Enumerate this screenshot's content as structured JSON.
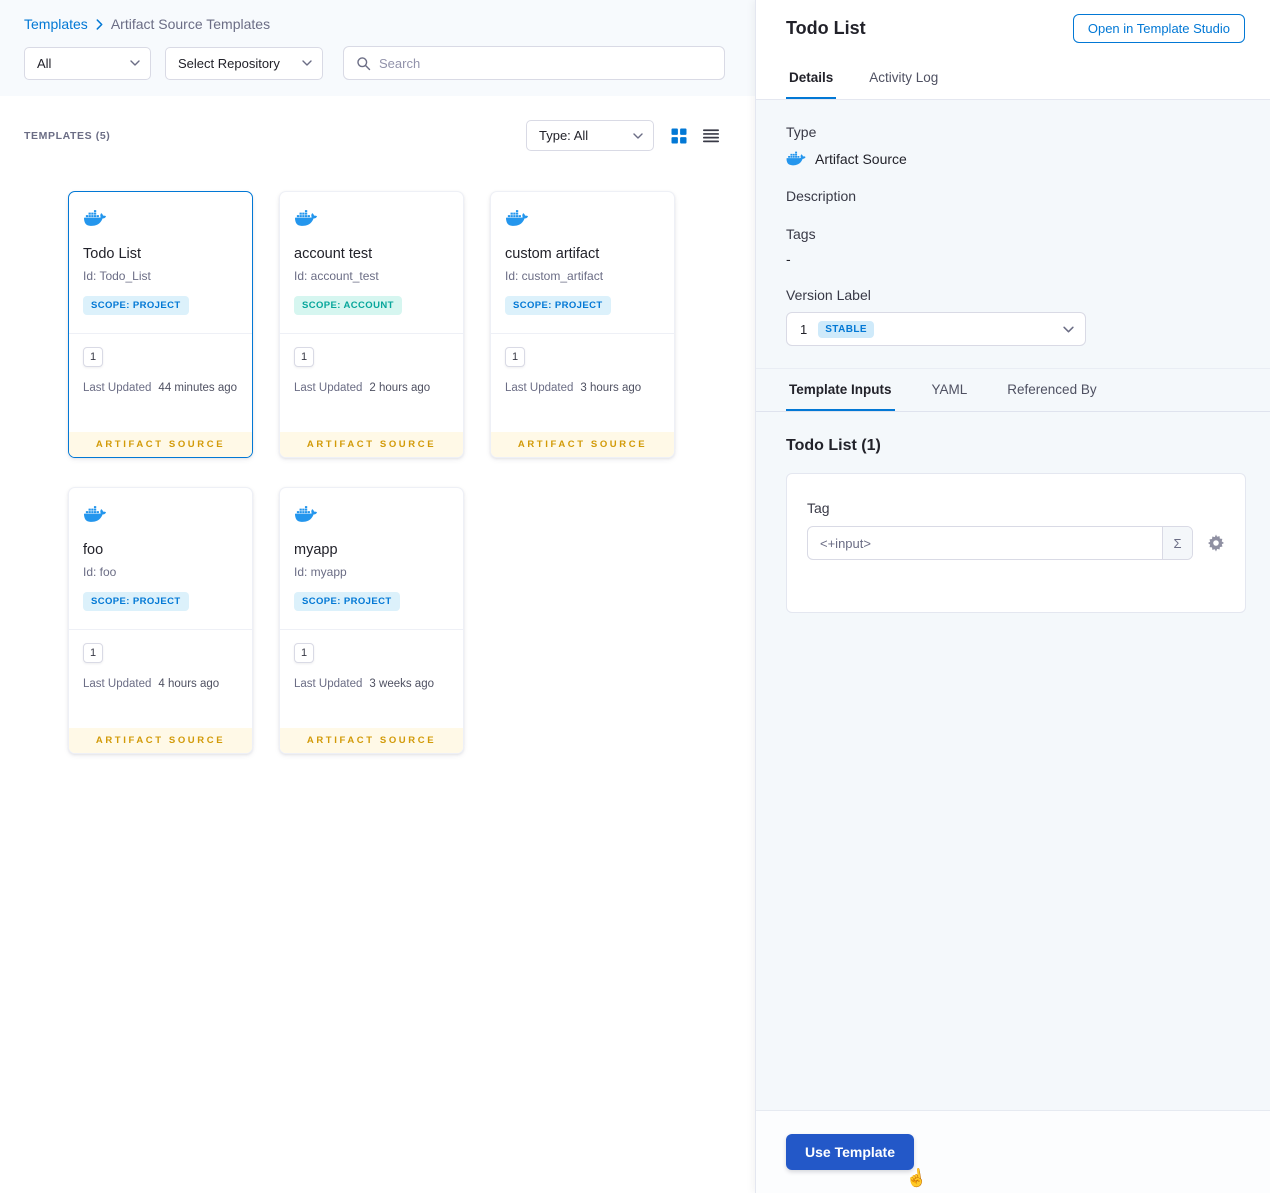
{
  "colors": {
    "accent": "#0278d5",
    "docker_blue": "#2496ed",
    "artifact_footer_text": "#d29a08",
    "artifact_footer_bg": "#fff9e7",
    "scope_project_bg": "#dcf1fb",
    "scope_project_text": "#0278d5",
    "scope_account_bg": "#d6f6f0",
    "scope_account_text": "#07a69b",
    "stable_badge_bg": "#cfeafa",
    "use_template_bg": "#2358c8"
  },
  "breadcrumb": {
    "root": "Templates",
    "current": "Artifact Source Templates"
  },
  "filters": {
    "scope": "All",
    "repository": "Select Repository",
    "search_placeholder": "Search"
  },
  "list_header": {
    "count": "TEMPLATES (5)",
    "type_filter": "Type: All"
  },
  "labels": {
    "last_updated": "Last Updated"
  },
  "cards": [
    {
      "name": "Todo List",
      "id": "Id: Todo_List",
      "scope": "SCOPE: PROJECT",
      "version": "1",
      "last_updated": "44 minutes ago",
      "footer": "ARTIFACT SOURCE"
    },
    {
      "name": "account test",
      "id": "Id: account_test",
      "scope": "SCOPE: ACCOUNT",
      "version": "1",
      "last_updated": "2 hours ago",
      "footer": "ARTIFACT SOURCE"
    },
    {
      "name": "custom artifact",
      "id": "Id: custom_artifact",
      "scope": "SCOPE: PROJECT",
      "version": "1",
      "last_updated": "3 hours ago",
      "footer": "ARTIFACT SOURCE"
    },
    {
      "name": "foo",
      "id": "Id: foo",
      "scope": "SCOPE: PROJECT",
      "version": "1",
      "last_updated": "4 hours ago",
      "footer": "ARTIFACT SOURCE"
    },
    {
      "name": "myapp",
      "id": "Id: myapp",
      "scope": "SCOPE: PROJECT",
      "version": "1",
      "last_updated": "3 weeks ago",
      "footer": "ARTIFACT SOURCE"
    }
  ],
  "panel": {
    "title": "Todo List",
    "open_studio": "Open in Template Studio",
    "tabs": {
      "details": "Details",
      "activity_log": "Activity Log"
    },
    "type_label": "Type",
    "type_value": "Artifact Source",
    "description_label": "Description",
    "tags_label": "Tags",
    "tags_value": "-",
    "version_label": "Version Label",
    "version_value": "1",
    "version_badge": "STABLE",
    "inner_tabs": {
      "inputs": "Template Inputs",
      "yaml": "YAML",
      "referenced": "Referenced By"
    },
    "inputs_title": "Todo List (1)",
    "tag_label": "Tag",
    "tag_value": "<+input>",
    "use_template": "Use Template"
  },
  "icons": {
    "sigma": "Σ",
    "cursor": "☝"
  }
}
